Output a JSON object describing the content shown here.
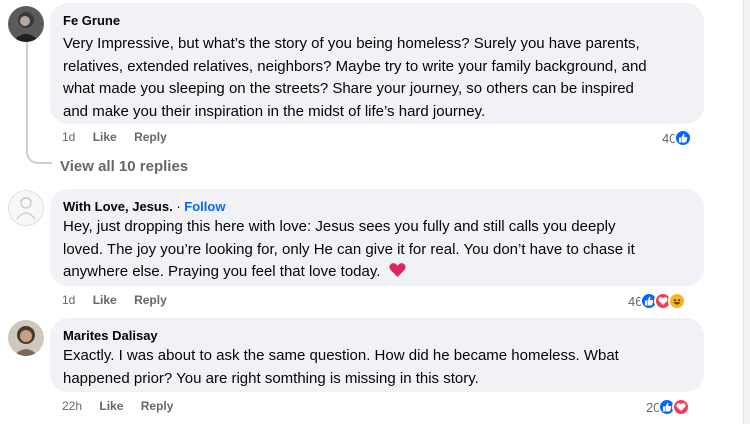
{
  "comments": [
    {
      "author": "Fe Grune",
      "lines": [
        "Very Impressive, but what’s the story of you being homeless? Surely you have parents,",
        "relatives, extended relatives, neighbors? Maybe try to write your family background, and",
        "what made you sleeping on the streets? Share your journey, so others can be inspired",
        "and make you their inspiration in the midst of life’s hard journey."
      ],
      "time": "1d",
      "like_label": "Like",
      "reply_label": "Reply",
      "reaction_count": "40",
      "reactions": [
        "like-reaction-icon"
      ]
    },
    {
      "author": "With Love, Jesus.",
      "separator": "·",
      "follow_label": "Follow",
      "lines": [
        "Hey, just dropping this here with love: Jesus sees you fully and still calls you deeply",
        "loved. The joy you’re looking for, only He can give it for real. You don’t have to chase it",
        "anywhere else. Praying you feel that love today."
      ],
      "emoji": "red-heart-emoji",
      "time": "1d",
      "like_label": "Like",
      "reply_label": "Reply",
      "reaction_count": "46",
      "reactions": [
        "like-reaction-icon",
        "love-reaction-icon",
        "haha-reaction-icon"
      ]
    },
    {
      "author": "Marites Dalisay",
      "lines": [
        "Exactly. I was about to ask the same question. How did he became homeless. Wbat",
        "happened prior? You are right somthing is missing in this story."
      ],
      "time": "22h",
      "like_label": "Like",
      "reply_label": "Reply",
      "reaction_count": "20",
      "reactions": [
        "like-reaction-icon",
        "love-reaction-icon"
      ]
    }
  ],
  "view_replies_label": "View all 10 replies",
  "colors": {
    "bubble": "#f0f2f5",
    "link": "#0866ff",
    "meta": "#65676b",
    "like": "#0866ff",
    "love": "#f33e58",
    "haha": "#f7b125"
  }
}
